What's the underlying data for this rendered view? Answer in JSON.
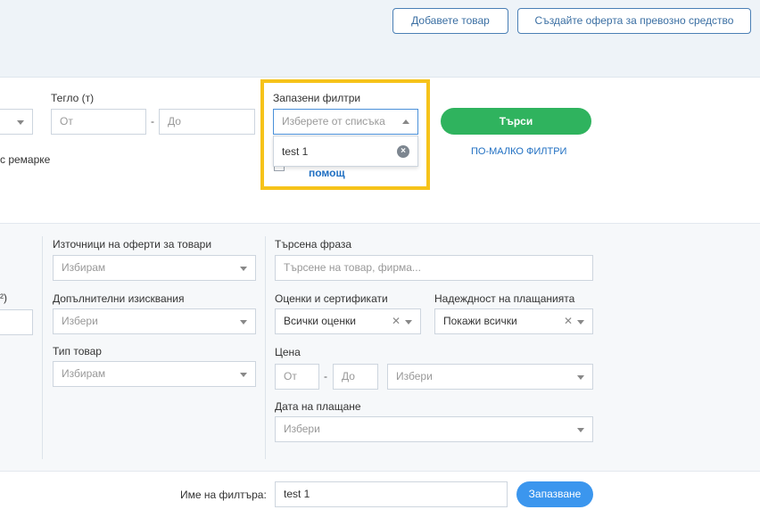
{
  "header": {
    "add_cargo": "Добавете товар",
    "create_vehicle_offer": "Създайте оферта за превозно средство"
  },
  "filters": {
    "weight_label": "Тегло (т)",
    "weight_from": "От",
    "weight_to": "До",
    "weight_dash": "-",
    "saved_filters_label": "Запазени филтри",
    "saved_filters_placeholder": "Изберете от списъка",
    "saved_filters_option": "test 1",
    "search_button": "Търси",
    "fewer_filters": "ПО-МАЛКО ФИЛТРИ",
    "partial_trailer": "с ремарке",
    "partial_help": "помощ"
  },
  "advanced": {
    "partial_label": "²)",
    "sources_label": "Източници на оферти за товари",
    "sources_value": "Избирам",
    "extra_req_label": "Допълнителни изисквания",
    "extra_req_value": "Избери",
    "cargo_type_label": "Тип товар",
    "cargo_type_value": "Избирам",
    "search_phrase_label": "Търсена фраза",
    "search_phrase_placeholder": "Търсене на товар, фирма...",
    "ratings_label": "Оценки и сертификати",
    "ratings_value": "Всички оценки",
    "payment_reliability_label": "Надеждност на плащанията",
    "payment_reliability_value": "Покажи всички",
    "price_label": "Цена",
    "price_from": "От",
    "price_to": "До",
    "price_dash": "-",
    "price_currency": "Избери",
    "payment_date_label": "Дата на плащане",
    "payment_date_value": "Избери"
  },
  "footer": {
    "filter_name_label": "Име на филтъра:",
    "filter_name_value": "test 1",
    "save_button": "Запазване"
  },
  "colors": {
    "highlight": "#f6c31a",
    "search_green": "#2fb35e",
    "save_blue": "#3b96ee",
    "header_bg": "#eef3f8"
  }
}
